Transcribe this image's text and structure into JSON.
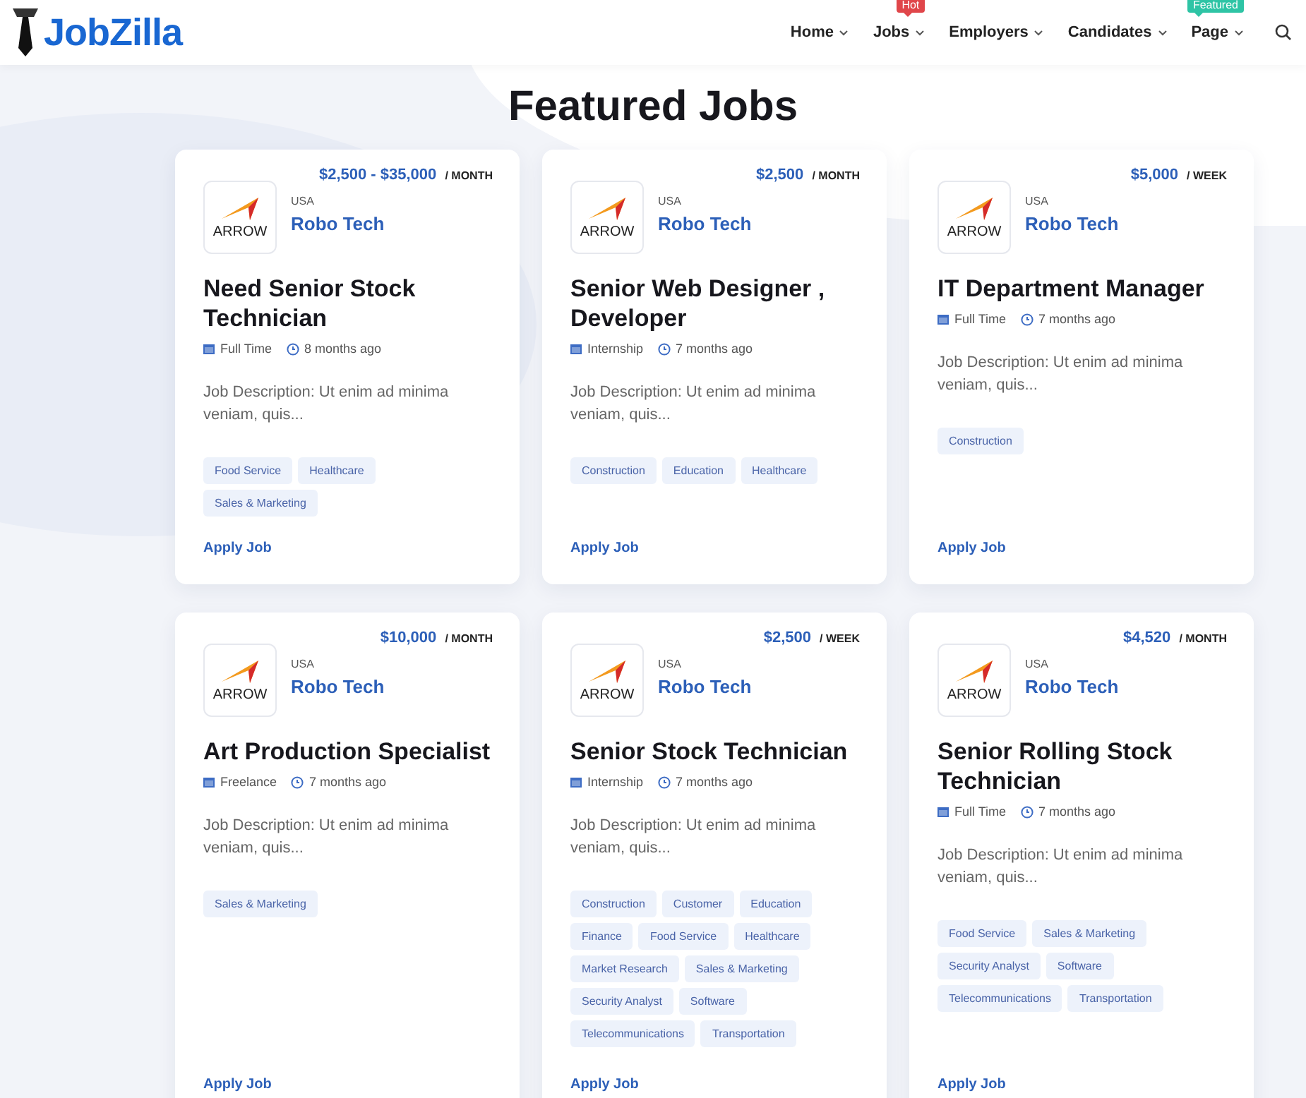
{
  "header": {
    "logo": "JobZilla",
    "nav": [
      {
        "label": "Home"
      },
      {
        "label": "Jobs",
        "badge": {
          "text": "Hot",
          "color": "#e0464a"
        }
      },
      {
        "label": "Employers"
      },
      {
        "label": "Candidates"
      },
      {
        "label": "Page",
        "badge": {
          "text": "Featured",
          "color": "#2ec4a5"
        }
      }
    ]
  },
  "section_title": "Featured Jobs",
  "jobs": [
    {
      "salary": "$2,500 - $35,000",
      "period": "/ MONTH",
      "logo_text": "ARROW",
      "country": "USA",
      "company": "Robo Tech",
      "title": "Need Senior Stock Technician",
      "type": "Full Time",
      "posted": "8 months ago",
      "description": "Job Description: Ut enim ad minima veniam, quis...",
      "tags": [
        "Food Service",
        "Healthcare",
        "Sales & Marketing"
      ],
      "action": "Apply Job"
    },
    {
      "salary": "$2,500",
      "period": "/ MONTH",
      "logo_text": "ARROW",
      "country": "USA",
      "company": "Robo Tech",
      "title": "Senior Web Designer , Developer",
      "type": "Internship",
      "posted": "7 months ago",
      "description": "Job Description: Ut enim ad minima veniam, quis...",
      "tags": [
        "Construction",
        "Education",
        "Healthcare"
      ],
      "action": "Apply Job"
    },
    {
      "salary": "$5,000",
      "period": "/ WEEK",
      "logo_text": "ARROW",
      "country": "USA",
      "company": "Robo Tech",
      "title": "IT Department Manager",
      "type": "Full Time",
      "posted": "7 months ago",
      "description": "Job Description: Ut enim ad minima veniam, quis...",
      "tags": [
        "Construction"
      ],
      "action": "Apply Job"
    },
    {
      "salary": "$10,000",
      "period": "/ MONTH",
      "logo_text": "ARROW",
      "country": "USA",
      "company": "Robo Tech",
      "title": "Art Production Specialist",
      "type": "Freelance",
      "posted": "7 months ago",
      "description": "Job Description: Ut enim ad minima veniam, quis...",
      "tags": [
        "Sales & Marketing"
      ],
      "action": "Apply Job"
    },
    {
      "salary": "$2,500",
      "period": "/ WEEK",
      "logo_text": "ARROW",
      "country": "USA",
      "company": "Robo Tech",
      "title": "Senior Stock Technician",
      "type": "Internship",
      "posted": "7 months ago",
      "description": "Job Description: Ut enim ad minima veniam, quis...",
      "tags": [
        "Construction",
        "Customer",
        "Education",
        "Finance",
        "Food Service",
        "Healthcare",
        "Market Research",
        "Sales & Marketing",
        "Security Analyst",
        "Software",
        "Telecommunications",
        "Transportation"
      ],
      "action": "Apply Job"
    },
    {
      "salary": "$4,520",
      "period": "/ MONTH",
      "logo_text": "ARROW",
      "country": "USA",
      "company": "Robo Tech",
      "title": "Senior Rolling Stock Technician",
      "type": "Full Time",
      "posted": "7 months ago",
      "description": "Job Description: Ut enim ad minima veniam, quis...",
      "tags": [
        "Food Service",
        "Sales & Marketing",
        "Security Analyst",
        "Software",
        "Telecommunications",
        "Transportation"
      ],
      "action": "Apply Job"
    }
  ]
}
